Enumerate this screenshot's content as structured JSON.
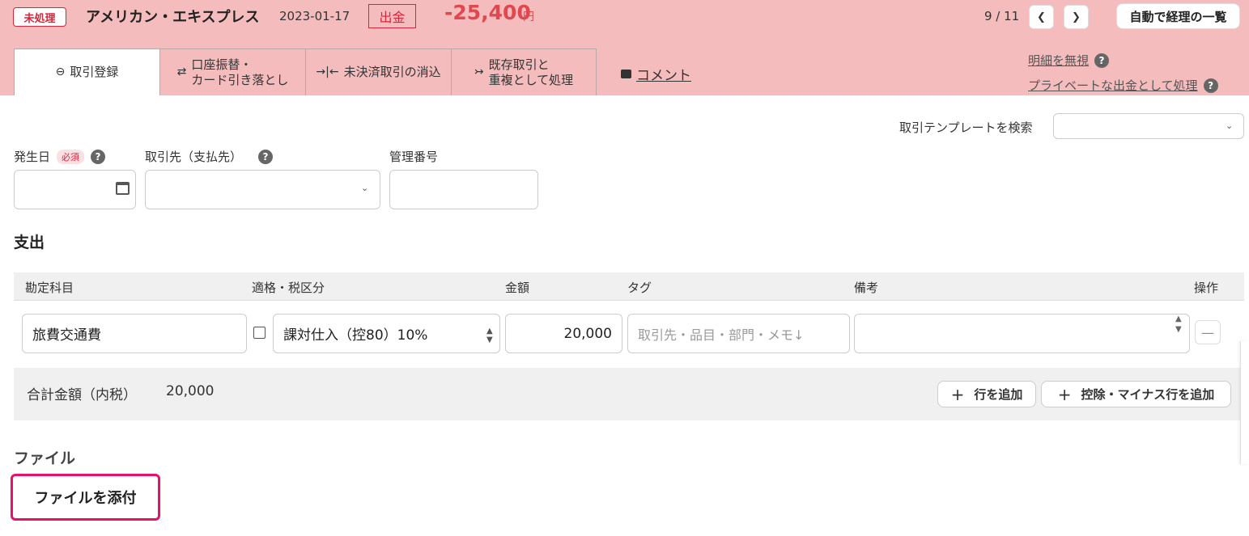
{
  "header": {
    "status": "未処理",
    "account": "アメリカン・エキスプレス",
    "date": "2023-01-17",
    "type": "出金",
    "amount": "-25,400",
    "currency": "円",
    "page_count": "9 / 11",
    "prev_icon": "chevron-left-icon",
    "next_icon": "chevron-right-icon",
    "list_button": "自動で経理の一覧"
  },
  "tabs": [
    {
      "label": "取引登録",
      "icon": "minus-circle-icon"
    },
    {
      "label": "口座振替・\nカード引き落とし",
      "icon": "swap-icon"
    },
    {
      "label": "未決済取引の消込",
      "icon": "merge-icon"
    },
    {
      "label": "既存取引と\n重複として処理",
      "icon": "duplicate-icon"
    }
  ],
  "comment_link": "コメント",
  "side_links": {
    "ignore": "明細を無視",
    "private": "プライベートな出金として処理"
  },
  "template": {
    "label": "取引テンプレートを検索",
    "value": ""
  },
  "fields": {
    "date_label": "発生日",
    "required": "必須",
    "partner_label": "取引先（支払先）",
    "mgmt_label": "管理番号",
    "date_value": "",
    "partner_value": "",
    "mgmt_value": ""
  },
  "section_title": "支出",
  "table": {
    "columns": [
      "勘定科目",
      "適格・税区分",
      "金額",
      "タグ",
      "備考",
      "操作"
    ],
    "rows": [
      {
        "account": "旅費交通費",
        "tax": "課対仕入（控80）10%",
        "amount": "20,000",
        "tag_placeholder": "取引先・品目・部門・メモ↓",
        "note": ""
      }
    ]
  },
  "total": {
    "label": "合計金額（内税）",
    "value": "20,000"
  },
  "buttons": {
    "add_row": "行を追加",
    "add_deduction": "控除・マイナス行を追加"
  },
  "file": {
    "title": "ファイル",
    "attach": "ファイルを添付"
  },
  "colors": {
    "top_band": "#f4bcbd",
    "accent_red": "#d6263c",
    "amount_red": "#e0484f",
    "highlight": "#e8106b"
  }
}
